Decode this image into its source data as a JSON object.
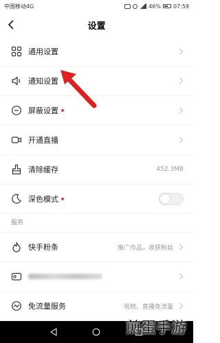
{
  "status_bar": {
    "carrier": "中国移动4G",
    "battery": "46%",
    "time": "07:59"
  },
  "nav": {
    "title": "设置"
  },
  "rows": [
    {
      "label": "通用设置",
      "icon": "grid-icon"
    },
    {
      "label": "通知设置",
      "icon": "speaker-icon"
    },
    {
      "label": "屏蔽设置",
      "icon": "minus-circle-icon",
      "dot": true
    },
    {
      "label": "开通直播",
      "icon": "camera-icon"
    },
    {
      "label": "清除缓存",
      "icon": "clean-icon",
      "value": "452.3MB"
    },
    {
      "label": "深色模式",
      "icon": "moon-icon",
      "dot": true,
      "toggle": false
    }
  ],
  "section": {
    "title": "服务"
  },
  "service_rows": [
    {
      "label": "快手粉条",
      "icon": "fire-icon",
      "value": "推广作品，收获粉丝"
    },
    {
      "label": "",
      "icon": "wallet-icon",
      "blurred": true
    },
    {
      "label": "免流量服务",
      "icon": "wave-icon",
      "value": "视频、直播免流量"
    }
  ],
  "watermark": "煎蛋手游",
  "colors": {
    "dot_red": "#f2384b",
    "arrow_red": "#e0201f",
    "nav_bar": "#000000"
  }
}
